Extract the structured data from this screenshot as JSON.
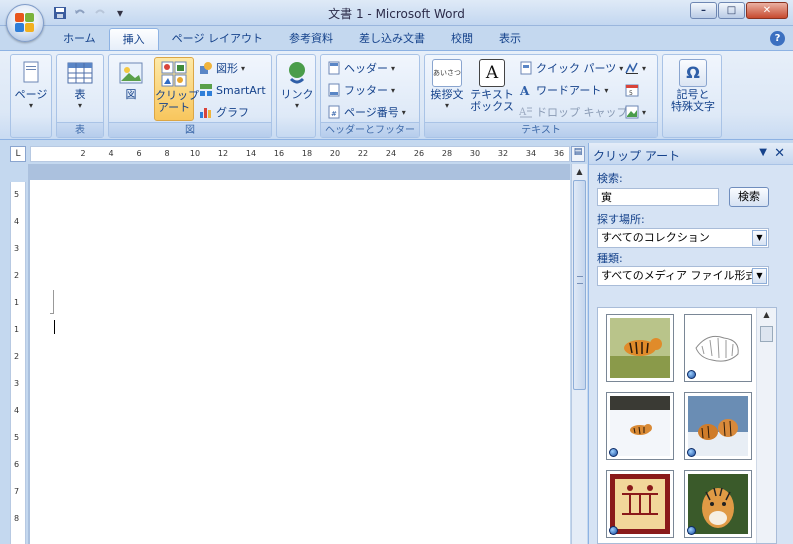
{
  "window": {
    "title": "文書 1 - Microsoft Word",
    "controls": {
      "minimize": "–",
      "maximize": "□",
      "close": "✕"
    }
  },
  "quick_access": {
    "save_icon": "save-icon",
    "undo_icon": "undo-icon",
    "customize": "▾"
  },
  "tabs": [
    {
      "label": "ホーム"
    },
    {
      "label": "挿入"
    },
    {
      "label": "ページ レイアウト"
    },
    {
      "label": "参考資料"
    },
    {
      "label": "差し込み文書"
    },
    {
      "label": "校閲"
    },
    {
      "label": "表示"
    }
  ],
  "active_tab": "挿入",
  "ribbon": {
    "pages": {
      "label": "ページ"
    },
    "table": {
      "label": "表",
      "group": "表"
    },
    "illustrations": {
      "group": "図",
      "picture": "図",
      "clipart": "クリップ\nアート",
      "clipart_l1": "クリップ",
      "clipart_l2": "アート",
      "shapes": "図形",
      "smartart": "SmartArt",
      "chart": "グラフ"
    },
    "links": {
      "label": "リンク"
    },
    "header_footer": {
      "group": "ヘッダーとフッター",
      "header": "ヘッダー",
      "footer": "フッター",
      "page_number": "ページ番号"
    },
    "text": {
      "group": "テキスト",
      "greeting": "挨拶文",
      "greeting_icon_text": "あいさつ",
      "textbox_l1": "テキスト",
      "textbox_l2": "ボックス",
      "quickparts": "クイック パーツ",
      "wordart": "ワードアート",
      "dropcap": "ドロップ キャップ"
    },
    "symbols": {
      "label_l1": "記号と",
      "label_l2": "特殊文字"
    }
  },
  "ruler": {
    "h_ticks": [
      "2",
      "4",
      "6",
      "8",
      "10",
      "12",
      "14",
      "16",
      "18",
      "20",
      "22",
      "24",
      "26",
      "28",
      "30",
      "32",
      "34",
      "36"
    ],
    "v_ticks": [
      "5",
      "4",
      "3",
      "2",
      "1",
      "1",
      "2",
      "3",
      "4",
      "5",
      "6",
      "7",
      "8"
    ],
    "corner": "L"
  },
  "clipart_pane": {
    "title": "クリップ アート",
    "search_label": "検索:",
    "search_value": "寅",
    "search_button": "検索",
    "location_label": "探す場所:",
    "location_value": "すべてのコレクション",
    "type_label": "種類:",
    "type_value": "すべてのメディア ファイル形式"
  },
  "colors": {
    "ribbon_bg": "#dbe7f6",
    "accent": "#15428b",
    "selected": "#f8c65d"
  }
}
